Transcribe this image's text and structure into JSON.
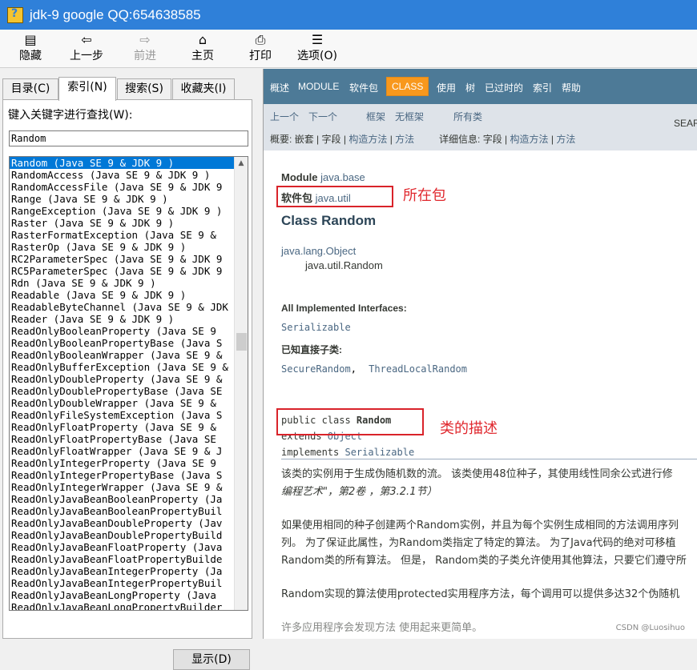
{
  "window": {
    "title": "jdk-9 google QQ:654638585"
  },
  "toolbar": {
    "hide": {
      "glyph": "▤",
      "label": "隐藏"
    },
    "back": {
      "glyph": "⇦",
      "label": "上一步"
    },
    "forward": {
      "glyph": "⇨",
      "label": "前进"
    },
    "home": {
      "glyph": "⌂",
      "label": "主页"
    },
    "print": {
      "glyph": "⎙",
      "label": "打印"
    },
    "options": {
      "glyph": "☰",
      "label": "选项(O)"
    }
  },
  "left": {
    "tabs": [
      "目录(C)",
      "索引(N)",
      "搜索(S)",
      "收藏夹(I)"
    ],
    "keyword_label": "键入关键字进行查找(W):",
    "keyword_value": "Random",
    "list": [
      "Random (Java SE 9 & JDK 9 )",
      "RandomAccess (Java SE 9 & JDK 9 )",
      "RandomAccessFile (Java SE 9 & JDK 9",
      "Range (Java SE 9 & JDK 9 )",
      "RangeException (Java SE 9 & JDK 9 )",
      "Raster (Java SE 9 & JDK 9 )",
      "RasterFormatException (Java SE 9 &",
      "RasterOp (Java SE 9 & JDK 9 )",
      "RC2ParameterSpec (Java SE 9 & JDK 9",
      "RC5ParameterSpec (Java SE 9 & JDK 9",
      "Rdn (Java SE 9 & JDK 9 )",
      "Readable (Java SE 9 & JDK 9 )",
      "ReadableByteChannel (Java SE 9 & JDK",
      "Reader (Java SE 9 & JDK 9 )",
      "ReadOnlyBooleanProperty (Java SE 9",
      "ReadOnlyBooleanPropertyBase (Java S",
      "ReadOnlyBooleanWrapper (Java SE 9 &",
      "ReadOnlyBufferException (Java SE 9 &",
      "ReadOnlyDoubleProperty (Java SE 9 &",
      "ReadOnlyDoublePropertyBase (Java SE",
      "ReadOnlyDoubleWrapper (Java SE 9 &",
      "ReadOnlyFileSystemException (Java S",
      "ReadOnlyFloatProperty (Java SE 9 &",
      "ReadOnlyFloatPropertyBase (Java SE",
      "ReadOnlyFloatWrapper (Java SE 9 & J",
      "ReadOnlyIntegerProperty (Java SE 9",
      "ReadOnlyIntegerPropertyBase (Java S",
      "ReadOnlyIntegerWrapper (Java SE 9 &",
      "ReadOnlyJavaBeanBooleanProperty (Ja",
      "ReadOnlyJavaBeanBooleanPropertyBuil",
      "ReadOnlyJavaBeanDoubleProperty (Jav",
      "ReadOnlyJavaBeanDoublePropertyBuild",
      "ReadOnlyJavaBeanFloatProperty (Java",
      "ReadOnlyJavaBeanFloatPropertyBuilde",
      "ReadOnlyJavaBeanIntegerProperty (Ja",
      "ReadOnlyJavaBeanIntegerPropertyBuil",
      "ReadOnlyJavaBeanLongProperty (Java",
      "ReadOnlyJavaBeanLongPropertyBuilder"
    ],
    "display_button": "显示(D)"
  },
  "topnav": [
    "概述",
    "MODULE",
    "软件包",
    "CLASS",
    "使用",
    "树",
    "已过时的",
    "索引",
    "帮助"
  ],
  "subnav": {
    "prev": "上一个",
    "next": "下一个",
    "frames": "框架",
    "noframes": "无框架",
    "allclasses": "所有类",
    "search": "SEAR",
    "summary_label": "概要:",
    "nested": "嵌套",
    "field": "字段",
    "ctor": "构造方法",
    "method": "方法",
    "detail_label": "详细信息:",
    "d_field": "字段",
    "d_ctor": "构造方法",
    "d_method": "方法",
    "sep": "|"
  },
  "doc": {
    "module_label": "Module",
    "module_value": "java.base",
    "package_label": "软件包",
    "package_value": "java.util",
    "annotation_package": "所在包",
    "class_title": "Class Random",
    "hier_parent": "java.lang.Object",
    "hier_child": "java.util.Random",
    "impl_label": "All Implemented Interfaces:",
    "impl_value": "Serializable",
    "subclass_label": "已知直接子类:",
    "subclass_1": "SecureRandom",
    "subclass_sep": ",",
    "subclass_2": "ThreadLocalRandom",
    "decl_1a": "public class ",
    "decl_1b": "Random",
    "decl_2a": "extends ",
    "decl_2b": "Object",
    "decl_3a": "implements ",
    "decl_3b": "Serializable",
    "annotation_class": "类的描述",
    "p1_l1": "该类的实例用于生成伪随机数的流。 该类使用48位种子，其使用线性同余公式进行修",
    "p1_l2": "编程艺术\"，第2卷 ，第3.2.1节）",
    "p2_l1": "如果使用相同的种子创建两个Random实例，并且为每个实例生成相同的方法调用序列",
    "p2_l2": "列。 为了保证此属性，为Random类指定了特定的算法。 为了Java代码的绝对可移植",
    "p2_l3": "Random类的所有算法。 但是， Random类的子类允许使用其他算法，只要它们遵守所",
    "p3_l1": "Random实现的算法使用protected实用程序方法，每个调用可以提供多达32个伪随机",
    "p4_l1": "许多应用程序会发现方法                   使用起来更简单。",
    "watermark": "CSDN @Luosihuo"
  }
}
